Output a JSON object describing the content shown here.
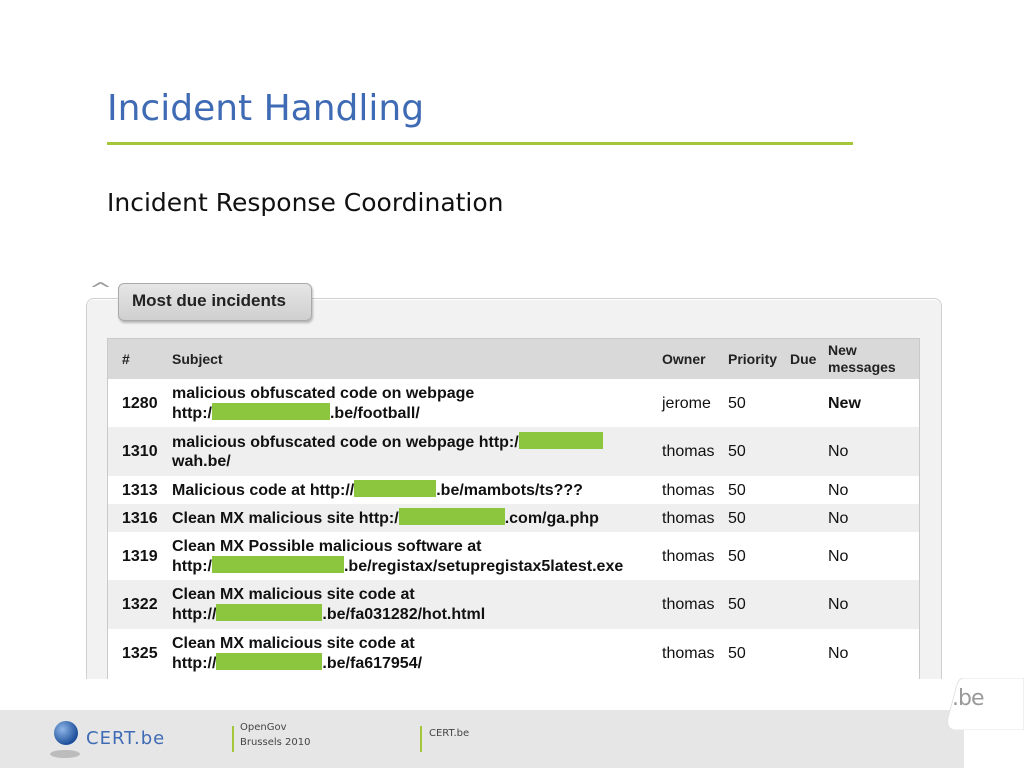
{
  "slide": {
    "title": "Incident Handling",
    "subtitle": "Incident Response Coordination"
  },
  "panel": {
    "tab_label": "Most due incidents",
    "collapse_icon": "chevron-up-icon"
  },
  "table": {
    "headers": {
      "num": "#",
      "subject": "Subject",
      "owner": "Owner",
      "priority": "Priority",
      "due": "Due",
      "new_messages": "New messages"
    },
    "rows": [
      {
        "id": "1280",
        "subject_a": "malicious obfuscated code on webpage",
        "subject_b1": "http:/",
        "subject_b2": ".be/football/",
        "owner": "jerome",
        "priority": "50",
        "due": "",
        "new": "New"
      },
      {
        "id": "1310",
        "subject_a": "malicious obfuscated code on webpage http:/",
        "subject_b1": "wah.be/",
        "subject_b2": "",
        "owner": "thomas",
        "priority": "50",
        "due": "",
        "new": "No"
      },
      {
        "id": "1313",
        "subject_a": "Malicious code at http://",
        "subject_a2": ".be/mambots/ts???",
        "owner": "thomas",
        "priority": "50",
        "due": "",
        "new": "No"
      },
      {
        "id": "1316",
        "subject_a": "Clean MX malicious site http:/",
        "subject_a2": ".com/ga.php",
        "owner": "thomas",
        "priority": "50",
        "due": "",
        "new": "No"
      },
      {
        "id": "1319",
        "subject_a": "Clean MX Possible malicious software at",
        "subject_b1": "http:/",
        "subject_b2": ".be/registax/setupregistax5latest.exe",
        "owner": "thomas",
        "priority": "50",
        "due": "",
        "new": "No"
      },
      {
        "id": "1322",
        "subject_a": "Clean MX malicious site code at",
        "subject_b1": "http://",
        "subject_b2": ".be/fa031282/hot.html",
        "owner": "thomas",
        "priority": "50",
        "due": "",
        "new": "No"
      },
      {
        "id": "1325",
        "subject_a": "Clean MX malicious site code at",
        "subject_b1": "http://",
        "subject_b2": ".be/fa617954/",
        "owner": "thomas",
        "priority": "50",
        "due": "",
        "new": "No"
      }
    ]
  },
  "footer": {
    "logo_text": "CERT.be",
    "event_line1": "OpenGov",
    "event_line2": "Brussels 2010",
    "org": "CERT.be",
    "badge": ".be"
  },
  "colors": {
    "title_blue": "#3f6bb5",
    "rule_green": "#a4c639",
    "redaction_green": "#8cc63f"
  }
}
